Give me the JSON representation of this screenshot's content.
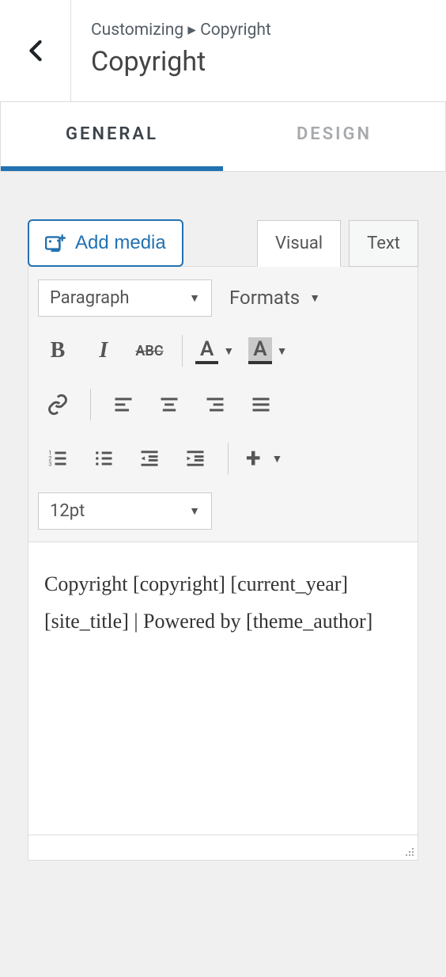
{
  "header": {
    "breadcrumb_prefix": "Customizing",
    "breadcrumb_current": "Copyright",
    "title": "Copyright"
  },
  "tabs": {
    "general": "GENERAL",
    "design": "DESIGN"
  },
  "toolbar": {
    "add_media": "Add media",
    "editor_tabs": {
      "visual": "Visual",
      "text": "Text"
    },
    "paragraph": "Paragraph",
    "formats": "Formats",
    "bold": "B",
    "italic": "I",
    "strike": "ABC",
    "color_letter": "A",
    "fontsize": "12pt",
    "plus": "+"
  },
  "content": {
    "body": "Copyright [copyright] [current_year] [site_title] | Powered by [theme_author]"
  }
}
